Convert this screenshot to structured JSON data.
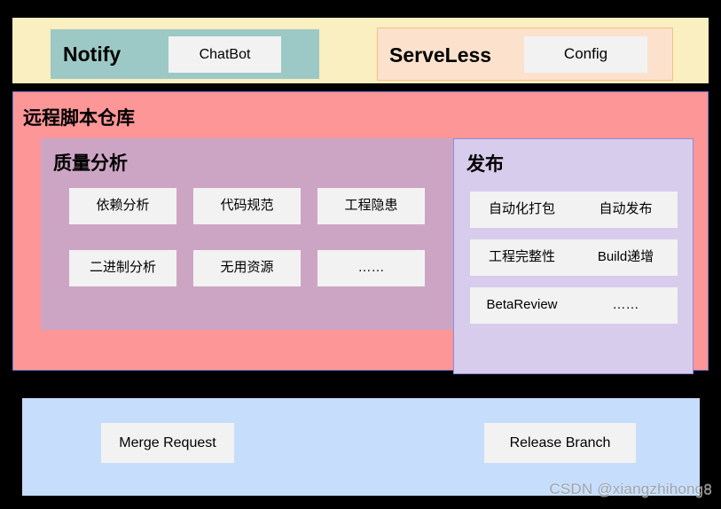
{
  "top_band": {
    "notify": {
      "label": "Notify",
      "items": [
        {
          "label": "ChatBot"
        }
      ]
    },
    "serveless": {
      "label": "ServeLess",
      "items": [
        {
          "label": "Config"
        }
      ]
    }
  },
  "repo_panel": {
    "title": "远程脚本仓库",
    "quality": {
      "title": "质量分析",
      "items": [
        {
          "label": "依赖分析"
        },
        {
          "label": "代码规范"
        },
        {
          "label": "工程隐患"
        },
        {
          "label": "二进制分析"
        },
        {
          "label": "无用资源"
        },
        {
          "label": "……"
        }
      ]
    },
    "publish": {
      "title": "发布",
      "items": [
        {
          "label": "自动化打包"
        },
        {
          "label": "自动发布"
        },
        {
          "label": "工程完整性"
        },
        {
          "label": "Build递增"
        },
        {
          "label": "BetaReview"
        },
        {
          "label": "……"
        }
      ]
    }
  },
  "branch_panel": {
    "items": [
      {
        "label": "Merge Request"
      },
      {
        "label": "Release Branch"
      }
    ]
  },
  "watermark": {
    "text": "CSDN @xiangzhihong8"
  },
  "colors": {
    "background": "#000000",
    "top_band": "#FAEFC0",
    "notify_group": "#9CC9C5",
    "serveless_group": "#FCE2CC",
    "serveless_border": "#F6BE8C",
    "repo_panel": "#FD9697",
    "repo_border": "#6F76C9",
    "quality_panel": "#CDA5C4",
    "publish_panel": "#D8CCEC",
    "publish_border": "#8C8CDC",
    "branch_panel": "#C6DEFB",
    "tile": "#F2F2F2",
    "text": "#000000"
  }
}
